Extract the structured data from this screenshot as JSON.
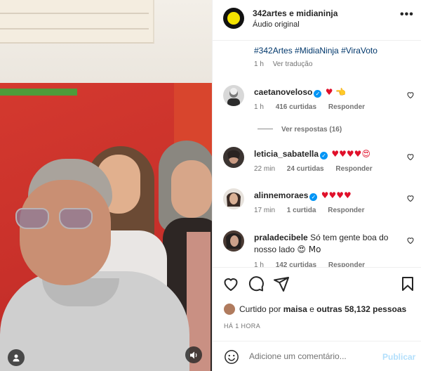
{
  "post": {
    "author_1": "342artes",
    "joiner": "e",
    "author_2": "midianinja",
    "audio": "Áudio original",
    "more": "•••"
  },
  "caption": {
    "text": "#342Artes #MidiaNinja #ViraVoto",
    "time": "1 h",
    "translate": "Ver tradução"
  },
  "comments": [
    {
      "user": "caetanoveloso",
      "verified": true,
      "text": "",
      "emoji": "♥ 👈",
      "time": "1 h",
      "likes": "416 curtidas",
      "reply": "Responder",
      "view_replies": "Ver respostas (16)"
    },
    {
      "user": "leticia_sabatella",
      "verified": true,
      "text": "",
      "emoji": "♥♥♥♥😍",
      "time": "22 min",
      "likes": "24 curtidas",
      "reply": "Responder"
    },
    {
      "user": "alinnemoraes",
      "verified": true,
      "text": "",
      "emoji": "♥♥♥♥",
      "time": "17 min",
      "likes": "1 curtida",
      "reply": "Responder"
    },
    {
      "user": "praladecibele",
      "verified": false,
      "text": "Só tem gente boa do nosso lado",
      "emoji": "😍 Mo",
      "time": "1 h",
      "likes": "142 curtidas",
      "reply": "Responder"
    }
  ],
  "likes": {
    "prefix": "Curtido por",
    "user": "maisa",
    "middle": "e",
    "others": "outras 58,132 pessoas"
  },
  "timestamp": "HÁ 1 HORA",
  "composer": {
    "placeholder": "Adicione um comentário...",
    "post_label": "Publicar"
  },
  "colors": {
    "link": "#00376b",
    "verified": "#0095f6",
    "heart": "#e0102a",
    "post_disabled": "#b2dffc"
  },
  "icons": [
    "heart-icon",
    "comment-icon",
    "share-icon",
    "bookmark-icon",
    "emoji-icon",
    "user-tag-icon",
    "sound-icon",
    "more-icon"
  ]
}
